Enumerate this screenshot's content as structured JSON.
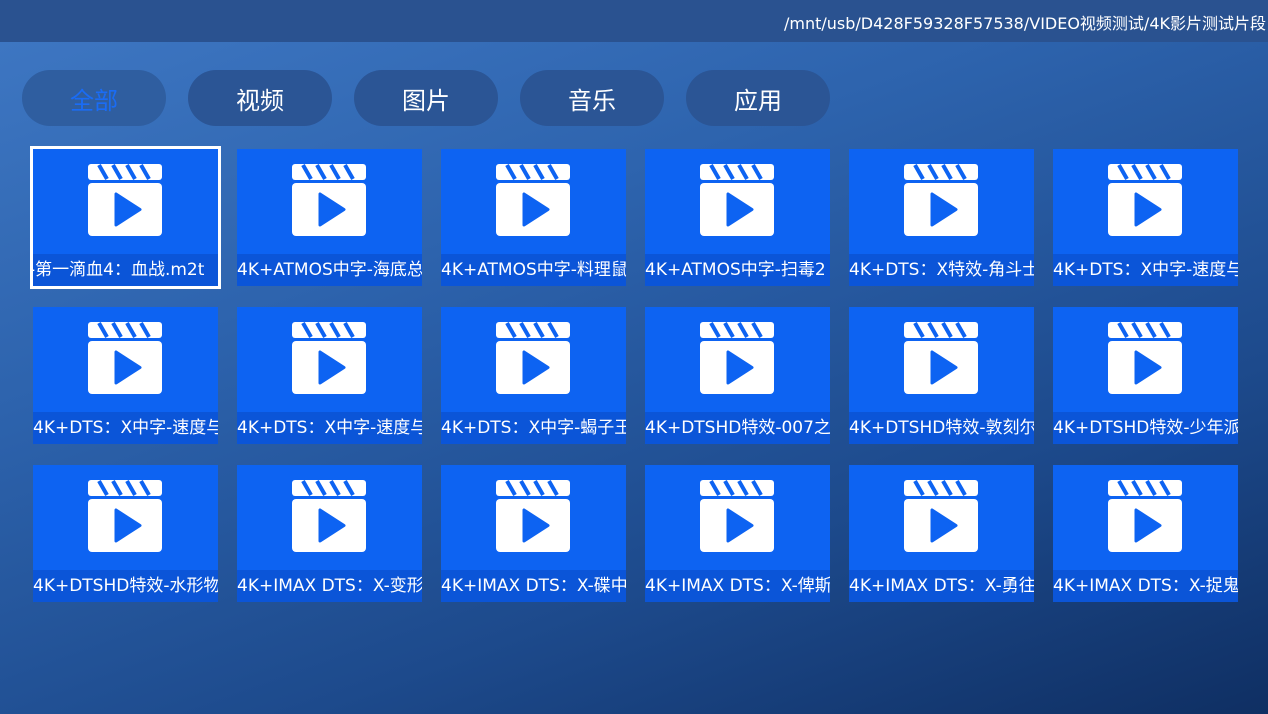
{
  "header": {
    "path": "/mnt/usb/D428F59328F57538/VIDEO视频测试/4K影片测试片段"
  },
  "tabs": [
    {
      "label": "全部",
      "active": true
    },
    {
      "label": "视频",
      "active": false
    },
    {
      "label": "图片",
      "active": false
    },
    {
      "label": "音乐",
      "active": false
    },
    {
      "label": "应用",
      "active": false
    }
  ],
  "files": [
    {
      "label": "-第一滴血4：血战.m2t",
      "icon": "video-file-icon",
      "focused": true
    },
    {
      "label": "4K+ATMOS中字-海底总",
      "icon": "video-file-icon"
    },
    {
      "label": "4K+ATMOS中字-料理鼠",
      "icon": "video-file-icon"
    },
    {
      "label": "4K+ATMOS中字-扫毒2",
      "icon": "video-file-icon"
    },
    {
      "label": "4K+DTS：X特效-角斗士",
      "icon": "video-file-icon"
    },
    {
      "label": "4K+DTS：X中字-速度与",
      "icon": "video-file-icon"
    },
    {
      "label": "4K+DTS：X中字-速度与",
      "icon": "video-file-icon"
    },
    {
      "label": "4K+DTS：X中字-速度与",
      "icon": "video-file-icon"
    },
    {
      "label": "4K+DTS：X中字-蝎子王",
      "icon": "video-file-icon"
    },
    {
      "label": "4K+DTSHD特效-007之",
      "icon": "video-file-icon"
    },
    {
      "label": "4K+DTSHD特效-敦刻尔",
      "icon": "video-file-icon"
    },
    {
      "label": "4K+DTSHD特效-少年派",
      "icon": "video-file-icon"
    },
    {
      "label": "4K+DTSHD特效-水形物",
      "icon": "video-file-icon"
    },
    {
      "label": "4K+IMAX DTS：X-变形",
      "icon": "video-file-icon"
    },
    {
      "label": "4K+IMAX DTS：X-碟中",
      "icon": "video-file-icon"
    },
    {
      "label": "4K+IMAX DTS：X-俾斯",
      "icon": "video-file-icon"
    },
    {
      "label": "4K+IMAX DTS：X-勇往",
      "icon": "video-file-icon"
    },
    {
      "label": "4K+IMAX DTS：X-捉鬼",
      "icon": "video-file-icon"
    }
  ],
  "colors": {
    "tile": "#0d63f2",
    "tab_active_text": "#1a6cf5",
    "tab_bg": "#2b5595"
  }
}
